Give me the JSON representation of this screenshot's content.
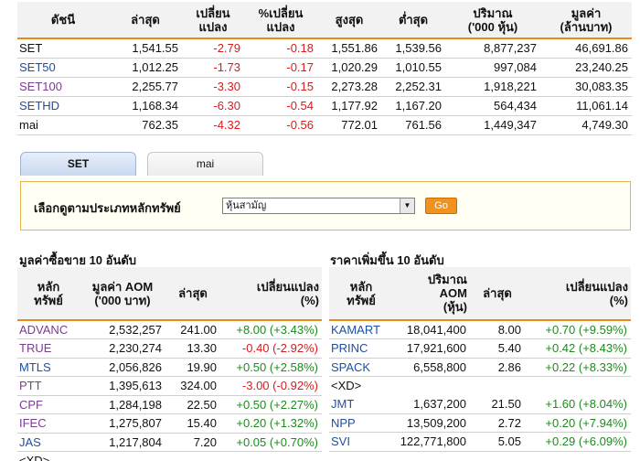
{
  "index_table": {
    "headers": [
      "ดัชนี",
      "ล่าสุด",
      "เปลี่ยน\nแปลง",
      "%เปลี่ยน\nแปลง",
      "สูงสุด",
      "ต่ำสุด",
      "ปริมาณ\n('000 หุ้น)",
      "มูลค่า\n(ล้านบาท)"
    ],
    "rows": [
      {
        "name": "SET",
        "last": "1,541.55",
        "change": "-2.79",
        "pct": "-0.18",
        "high": "1,551.86",
        "low": "1,539.56",
        "volume": "8,877,237",
        "value": "46,691.86",
        "name_color": "black"
      },
      {
        "name": "SET50",
        "last": "1,012.25",
        "change": "-1.73",
        "pct": "-0.17",
        "high": "1,020.29",
        "low": "1,010.55",
        "volume": "997,084",
        "value": "23,240.25",
        "name_color": "blue"
      },
      {
        "name": "SET100",
        "last": "2,255.77",
        "change": "-3.30",
        "pct": "-0.15",
        "high": "2,273.28",
        "low": "2,252.31",
        "volume": "1,918,221",
        "value": "30,083.35",
        "name_color": "purple"
      },
      {
        "name": "SETHD",
        "last": "1,168.34",
        "change": "-6.30",
        "pct": "-0.54",
        "high": "1,177.92",
        "low": "1,167.20",
        "volume": "564,434",
        "value": "11,061.14",
        "name_color": "blue"
      },
      {
        "name": "mai",
        "last": "762.35",
        "change": "-4.32",
        "pct": "-0.56",
        "high": "772.01",
        "low": "761.56",
        "volume": "1,449,347",
        "value": "4,749.30",
        "name_color": "black"
      }
    ]
  },
  "tabs": [
    {
      "label": "SET",
      "active": true
    },
    {
      "label": "mai",
      "active": false
    }
  ],
  "filter": {
    "label": "เลือกดูตามประเภทหลักทรัพย์",
    "selected": "หุ้นสามัญ",
    "go_label": "Go"
  },
  "top_value": {
    "title": "มูลค่าซื้อขาย 10 อันดับ",
    "headers": [
      "หลัก\nทรัพย์",
      "มูลค่า AOM\n('000 บาท)",
      "ล่าสุด",
      "เปลี่ยนแปลง\n(%)"
    ],
    "rows": [
      {
        "name": "ADVANC",
        "value": "2,532,257",
        "last": "241.00",
        "change": "+8.00 (+3.43%)",
        "dir": "pos",
        "name_color": "purple"
      },
      {
        "name": "TRUE",
        "value": "2,230,274",
        "last": "13.30",
        "change": "-0.40 (-2.92%)",
        "dir": "neg",
        "name_color": "purple"
      },
      {
        "name": "MTLS",
        "value": "2,056,826",
        "last": "19.90",
        "change": "+0.50 (+2.58%)",
        "dir": "pos",
        "name_color": "blue"
      },
      {
        "name": "PTT",
        "value": "1,395,613",
        "last": "324.00",
        "change": "-3.00 (-0.92%)",
        "dir": "neg",
        "name_color": "purple"
      },
      {
        "name": "CPF",
        "value": "1,284,198",
        "last": "22.50",
        "change": "+0.50 (+2.27%)",
        "dir": "pos",
        "name_color": "purple"
      },
      {
        "name": "IFEC",
        "value": "1,275,807",
        "last": "15.40",
        "change": "+0.20 (+1.32%)",
        "dir": "pos",
        "name_color": "purple"
      },
      {
        "name": "JAS",
        "value": "1,217,804",
        "last": "7.20",
        "change": "+0.05 (+0.70%)",
        "dir": "pos",
        "name_color": "blue"
      }
    ],
    "trailing_note": "<XD>"
  },
  "top_gainers": {
    "title": "ราคาเพิ่มขึ้น 10 อันดับ",
    "headers": [
      "หลัก\nทรัพย์",
      "ปริมาณ\nAOM\n(หุ้น)",
      "ล่าสุด",
      "เปลี่ยนแปลง\n(%)"
    ],
    "rows": [
      {
        "name": "KAMART",
        "volume": "18,041,400",
        "last": "8.00",
        "change": "+0.70 (+9.59%)",
        "dir": "pos",
        "name_color": "blue"
      },
      {
        "name": "PRINC",
        "volume": "17,921,600",
        "last": "5.40",
        "change": "+0.42 (+8.43%)",
        "dir": "pos",
        "name_color": "blue"
      },
      {
        "name": "SPACK",
        "volume": "6,558,800",
        "last": "2.86",
        "change": "+0.22 (+8.33%)",
        "dir": "pos",
        "name_color": "blue",
        "note": "<XD>"
      },
      {
        "name": "JMT",
        "volume": "1,637,200",
        "last": "21.50",
        "change": "+1.60 (+8.04%)",
        "dir": "pos",
        "name_color": "blue"
      },
      {
        "name": "NPP",
        "volume": "13,509,200",
        "last": "2.72",
        "change": "+0.20 (+7.94%)",
        "dir": "pos",
        "name_color": "blue"
      },
      {
        "name": "SVI",
        "volume": "122,771,800",
        "last": "5.05",
        "change": "+0.29 (+6.09%)",
        "dir": "pos",
        "name_color": "blue"
      }
    ]
  },
  "colors": {
    "accent_orange": "#e78a16",
    "negative": "#d91b1b",
    "positive": "#1e8a1e",
    "link_blue": "#1f4fa2",
    "link_purple": "#7a3d8f"
  }
}
